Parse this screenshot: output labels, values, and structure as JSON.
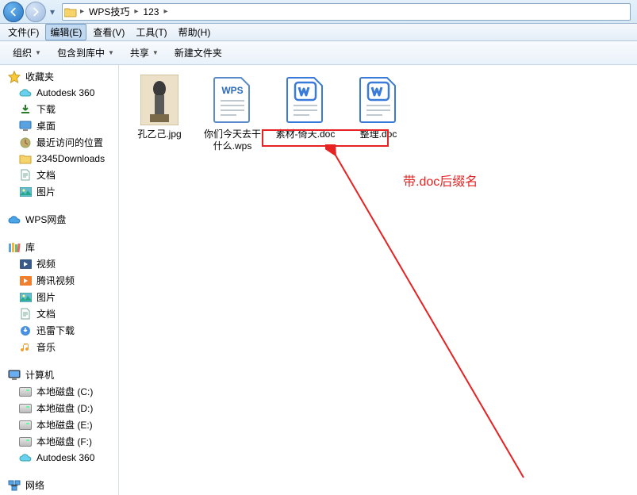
{
  "breadcrumb": {
    "seg1": "WPS技巧",
    "seg2": "123"
  },
  "menu": {
    "file": "文件(F)",
    "edit": "编辑(E)",
    "view": "查看(V)",
    "tools": "工具(T)",
    "help": "帮助(H)"
  },
  "toolbar": {
    "organize": "组织",
    "include": "包含到库中",
    "share": "共享",
    "newfolder": "新建文件夹"
  },
  "sidebar": {
    "favorites": {
      "head": "收藏夹",
      "items": [
        "Autodesk 360",
        "下载",
        "桌面",
        "最近访问的位置",
        "2345Downloads",
        "文档",
        "图片"
      ]
    },
    "wps": "WPS网盘",
    "libraries": {
      "head": "库",
      "items": [
        "视频",
        "腾讯视频",
        "图片",
        "文档",
        "迅雷下载",
        "音乐"
      ]
    },
    "computer": {
      "head": "计算机",
      "items": [
        "本地磁盘 (C:)",
        "本地磁盘 (D:)",
        "本地磁盘 (E:)",
        "本地磁盘 (F:)",
        "Autodesk 360"
      ]
    },
    "network": "网络"
  },
  "files": [
    {
      "name": "孔乙己.jpg",
      "type": "image"
    },
    {
      "name": "你们今天去干什么.wps",
      "type": "wps"
    },
    {
      "name": "素材-倚天.doc",
      "type": "doc"
    },
    {
      "name": "整理.doc",
      "type": "doc"
    }
  ],
  "annotation": {
    "text": "带.doc后缀名"
  }
}
